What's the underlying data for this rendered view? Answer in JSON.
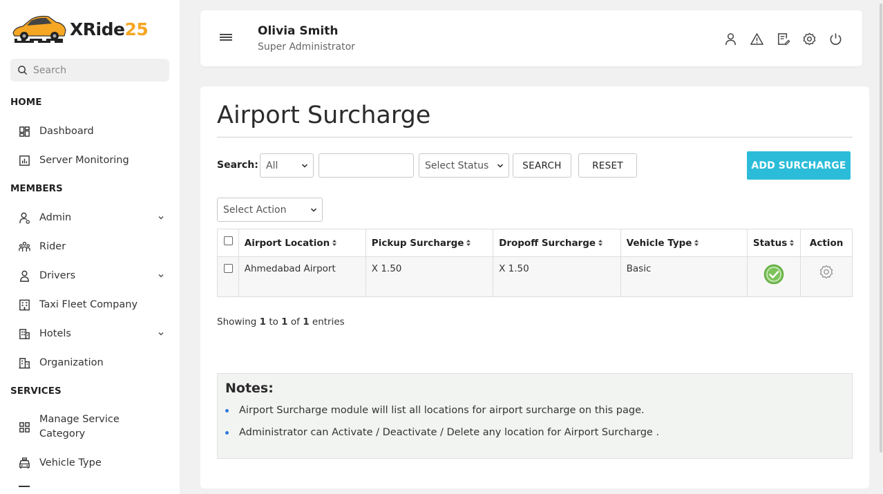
{
  "brand": {
    "name_prefix": "XRide",
    "name_suffix": "25",
    "accent": "#f5a623",
    "logo_icon": "car-logo-icon"
  },
  "sidebar": {
    "search_placeholder": "Search",
    "sections": [
      {
        "title": "HOME",
        "items": [
          {
            "label": "Dashboard",
            "icon": "dashboard-icon"
          },
          {
            "label": "Server Monitoring",
            "icon": "chart-icon"
          }
        ]
      },
      {
        "title": "MEMBERS",
        "items": [
          {
            "label": "Admin",
            "icon": "admin-icon",
            "expandable": true
          },
          {
            "label": "Rider",
            "icon": "rider-icon"
          },
          {
            "label": "Drivers",
            "icon": "driver-icon",
            "expandable": true
          },
          {
            "label": "Taxi Fleet Company",
            "icon": "building-icon"
          },
          {
            "label": "Hotels",
            "icon": "hotel-icon",
            "expandable": true
          },
          {
            "label": "Organization",
            "icon": "organization-icon"
          }
        ]
      },
      {
        "title": "SERVICES",
        "items": [
          {
            "label_line1": "Manage Service",
            "label_line2": "Category",
            "icon": "grid-icon"
          },
          {
            "label": "Vehicle Type",
            "icon": "vehicle-icon"
          }
        ]
      }
    ]
  },
  "header": {
    "user_name": "Olivia Smith",
    "user_role": "Super Administrator",
    "icons": [
      "profile-icon",
      "warning-icon",
      "edit-icon",
      "settings-icon",
      "power-icon"
    ]
  },
  "page": {
    "title": "Airport Surcharge",
    "search_label": "Search:",
    "filter_all": "All",
    "status_placeholder": "Select Status",
    "search_button": "SEARCH",
    "reset_button": "RESET",
    "add_button": "ADD SURCHARGE",
    "action_placeholder": "Select Action",
    "accent_button_color": "#2bbcd9"
  },
  "table": {
    "columns": [
      "Airport Location",
      "Pickup Surcharge",
      "Dropoff Surcharge",
      "Vehicle Type",
      "Status",
      "Action"
    ],
    "rows": [
      {
        "location": "Ahmedabad Airport",
        "pickup": "X 1.50",
        "dropoff": "X 1.50",
        "vehicle_type": "Basic",
        "status": "active",
        "status_color": "#7cc35a"
      }
    ]
  },
  "pagination": {
    "prefix": "Showing",
    "from": "1",
    "to_word": "to",
    "to": "1",
    "of_word": "of",
    "total": "1",
    "suffix": "entries"
  },
  "notes": {
    "title": "Notes:",
    "items": [
      "Airport Surcharge module will list all locations for airport surcharge on this page.",
      "Administrator can Activate / Deactivate / Delete any location for Airport Surcharge ."
    ],
    "bullet_color": "#2f7bd8"
  }
}
